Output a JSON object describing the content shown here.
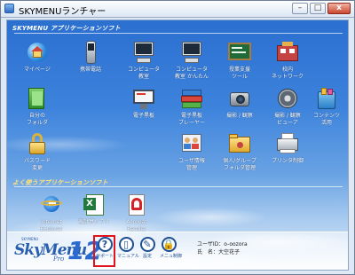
{
  "window": {
    "title": "SKYMENUランチャー",
    "buttons": {
      "minimize": "–",
      "maximize": "□",
      "close": "x"
    }
  },
  "sections": {
    "apps_header": "SKYMENU アプリケーションソフト",
    "favorites_header": "よく使うアプリケーションソフト"
  },
  "apps": [
    {
      "label": "マイページ",
      "icon": "globe-house-icon"
    },
    {
      "label": "携帯電話",
      "icon": "mobile-phone-icon"
    },
    {
      "label": "コンピュータ\n教室",
      "icon": "computer-icon"
    },
    {
      "label": "コンピュータ\n教室 かんたん",
      "icon": "computer-icon"
    },
    {
      "label": "授業支援\nツール",
      "icon": "blackboard-icon"
    },
    {
      "label": "校内\nネットワーク",
      "icon": "network-icon"
    },
    {
      "label": "自分の\nフォルダ",
      "icon": "folder-icon"
    },
    {
      "label": "電子黒板",
      "icon": "whiteboard-icon"
    },
    {
      "label": "電子黒板\nプレーヤー",
      "icon": "book-stack-icon"
    },
    {
      "label": "撮影 / 観察",
      "icon": "camera-icon"
    },
    {
      "label": "撮影 / 観察\nビューア",
      "icon": "film-reel-icon"
    },
    {
      "label": "コンテンツ\n活用",
      "icon": "content-icon"
    },
    {
      "label": "パスワード\n変更",
      "icon": "padlock-icon"
    },
    {
      "label": "ユーザ情報\n管理",
      "icon": "users-icon"
    },
    {
      "label": "個人/グループ\nフォルダ管理",
      "icon": "group-folder-icon"
    },
    {
      "label": "プリンタ制御",
      "icon": "printer-icon"
    }
  ],
  "favorites": [
    {
      "label": "Internet\nExplorer",
      "icon": "internet-explorer-icon"
    },
    {
      "label": "表計算ソフト",
      "icon": "spreadsheet-icon"
    },
    {
      "label": "Acrobat\nReader",
      "icon": "acrobat-icon"
    }
  ],
  "bottom": {
    "logo_small": "SKYMENU",
    "logo_script": "SkyMenu",
    "logo_pro": "Pro",
    "logo_version": "12",
    "tools": [
      {
        "label": "サポート",
        "glyph": "?",
        "icon": "help-icon"
      },
      {
        "label": "マニュアル",
        "glyph": "▯",
        "icon": "manual-icon"
      },
      {
        "label": "設定",
        "glyph": "✎",
        "icon": "settings-icon"
      },
      {
        "label": "メニュ制御",
        "glyph": "🔒",
        "icon": "menu-lock-icon"
      }
    ],
    "user_id_label": "ユーザID：",
    "user_id": "o-oozora",
    "user_name_label": "氏　名：",
    "user_name": "大空花子"
  },
  "colors": {
    "highlight": "#e0141e",
    "sky_top": "#2b6fd0",
    "brand": "#2a5fb0"
  }
}
